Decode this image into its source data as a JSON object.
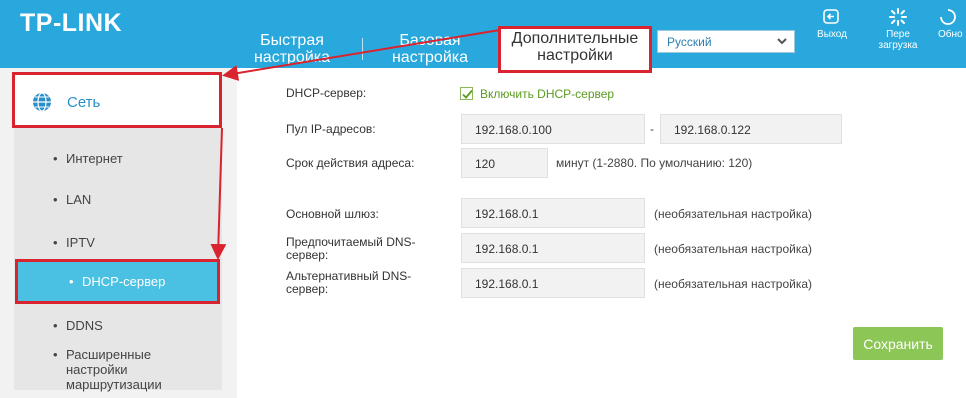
{
  "header": {
    "logo": "TP-LINK",
    "tabs": {
      "quick": "Быстрая настройка",
      "basic": "Базовая настройка",
      "advanced": "Дополнительные настройки"
    },
    "language": "Русский",
    "logout": "Выход",
    "reboot_1": "Пере",
    "reboot_2": "загрузка",
    "update": "Обно"
  },
  "sidebar": {
    "section": "Сеть",
    "items": [
      {
        "label": "Интернет"
      },
      {
        "label": "LAN"
      },
      {
        "label": "IPTV"
      },
      {
        "label": "DHCP-сервер"
      },
      {
        "label": "DDNS"
      },
      {
        "label": "Расширенные настройки маршрутизации"
      }
    ],
    "bullet": "•"
  },
  "form": {
    "dhcp_label": "DHCP-сервер:",
    "dhcp_checkbox": "Включить DHCP-сервер",
    "pool_label": "Пул IP-адресов:",
    "pool_start": "192.168.0.100",
    "pool_dash": "-",
    "pool_end": "192.168.0.122",
    "lease_label": "Срок действия адреса:",
    "lease_value": "120",
    "lease_note": "минут (1-2880. По умолчанию: 120)",
    "gateway_label": "Основной шлюз:",
    "gateway_value": "192.168.0.1",
    "dns1_label_1": "Предпочитаемый DNS-",
    "dns1_label_2": "сервер:",
    "dns1_value": "192.168.0.1",
    "dns2_label_1": "Альтернативный DNS-",
    "dns2_label_2": "сервер:",
    "dns2_value": "192.168.0.1",
    "optional_note": "(необязательная настройка)",
    "save": "Сохранить"
  },
  "colors": {
    "header": "#29a8dd",
    "annotation": "#d9232e",
    "active_item": "#4ac1e3",
    "save": "#8cc657"
  }
}
